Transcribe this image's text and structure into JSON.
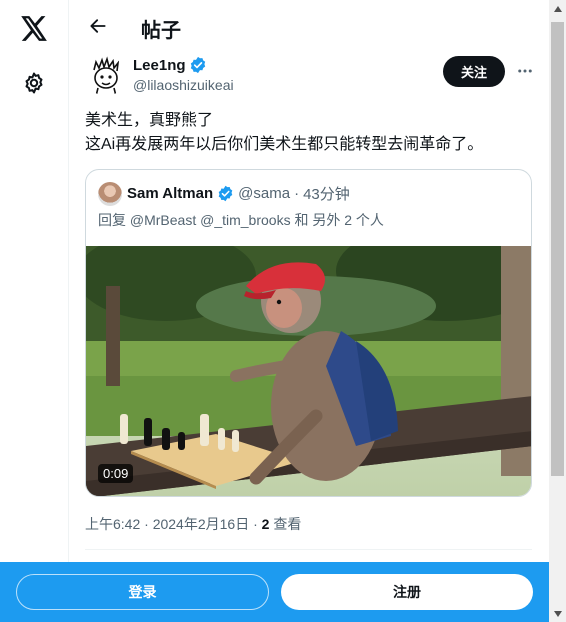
{
  "left_nav": {
    "logo_icon": "x-logo-icon",
    "settings_icon": "gear-icon"
  },
  "header": {
    "back_icon": "arrow-left-icon",
    "title": "帖子"
  },
  "tweet": {
    "author_name": "Lee1ng",
    "author_handle": "@lilaoshizuikeai",
    "verified_icon": "verified-badge-icon",
    "follow_label": "关注",
    "more_icon": "more-horizontal-icon",
    "text_line1": "美术生，真野熊了",
    "text_line2": "这Ai再发展两年以后你们美术生都只能转型去闹革命了。",
    "time": "上午6:42 · 2024年2月16日 · ",
    "views_count": "2",
    "views_label": " 查看"
  },
  "quote": {
    "author_name": "Sam Altman",
    "author_handle": "@sama",
    "separator": "·",
    "time_ago": "43分钟",
    "reply_to": "回复 @MrBeast @_tim_brooks 和 另外 2 个人",
    "video_duration": "0:09"
  },
  "bottom_bar": {
    "login_label": "登录",
    "signup_label": "注册"
  },
  "colors": {
    "brand_blue": "#1d9bf0",
    "text_primary": "#0f1419",
    "text_secondary": "#536471"
  }
}
